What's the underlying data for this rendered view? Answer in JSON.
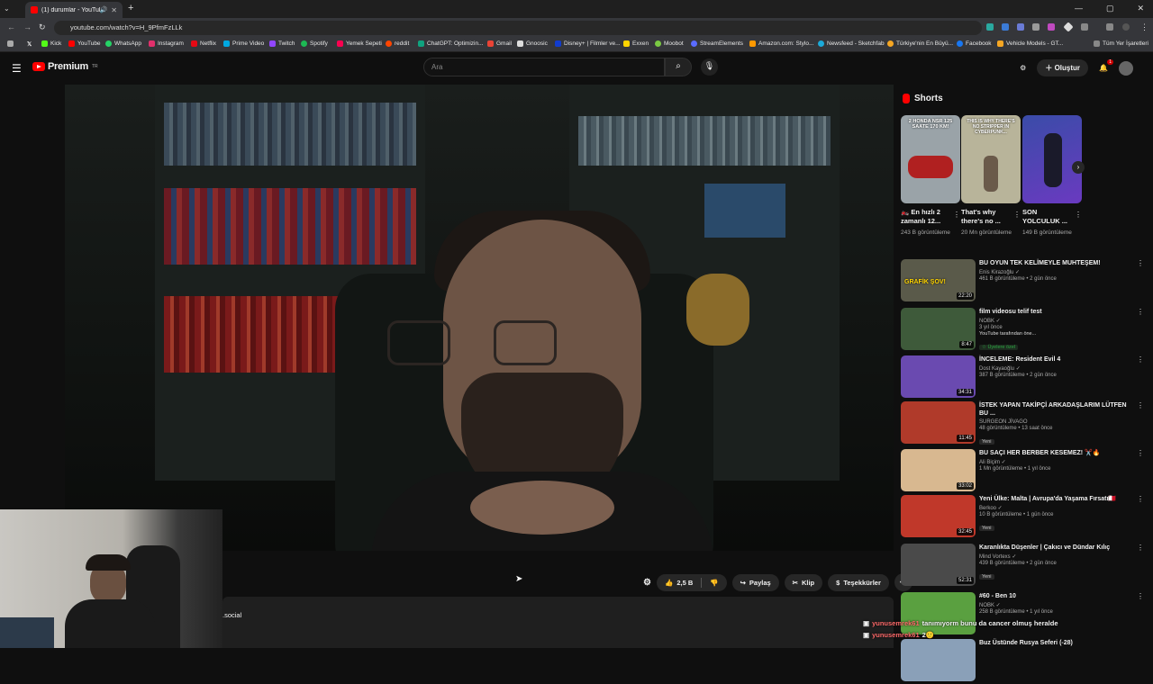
{
  "browser": {
    "tab_title": "(1) durumlar - YouTube",
    "url": "youtube.com/watch?v=H_9PfmFzLLk",
    "window_controls": [
      "—",
      "▢",
      "✕"
    ]
  },
  "bookmarks": [
    "Kick",
    "YouTube",
    "WhatsApp",
    "Instagram",
    "Netflix",
    "Prime Video",
    "Twitch",
    "Spotify",
    "Yemek Sepeti",
    "reddit",
    "ChatGPT: Optimizin...",
    "Gmail",
    "Gnoosic",
    "Disney+ | Filmler ve...",
    "Exxen",
    "Moobot",
    "StreamElements",
    "Amazon.com: Stylo...",
    "Newsfeed - Sketchfab",
    "Türkiye'nin En Büyü...",
    "Facebook",
    "Vehicle Models - GT..."
  ],
  "bookmarks_all": "Tüm Yer İşaretleri",
  "youtube": {
    "logo_text": "Premium",
    "logo_region": "TR",
    "search_placeholder": "Ara",
    "create_label": "Oluştur",
    "notif_count": "1"
  },
  "actions": {
    "like_count": "2,5 B",
    "share": "Paylaş",
    "clip": "Klip",
    "thanks": "Teşekkürler"
  },
  "description_fragment": ".social",
  "shorts": {
    "heading": "Shorts",
    "items": [
      {
        "title": "🏍️ En hızlı 2 zamanlı 12...",
        "views": "243 B görüntüleme",
        "thumb_color": "#9aa3a8",
        "thumb_text": "2 HONDA NSR 125 SAATE 170 KM!"
      },
      {
        "title": "That's why there's no ...",
        "views": "20 Mn görüntüleme",
        "thumb_color": "#b8b49a",
        "thumb_text": "THIS IS WHY THERE'S NO STRIPPER IN CYBERPUNK..."
      },
      {
        "title": "SON YOLCULUK ...",
        "views": "149 B görüntüleme",
        "thumb_color": "#3a4ca8",
        "thumb_text": ""
      }
    ]
  },
  "videos": [
    {
      "title": "BU OYUN TEK KELİMEYLE MUHTEŞEM!",
      "channel": "Enis Kirazoğlu ✓",
      "meta": "461 B görüntüleme • 2 gün önce",
      "duration": "22:20",
      "thumb_color": "#5a5a4a",
      "thumb_text": "GRAFİK ŞOV!"
    },
    {
      "title": "film videosu telif test",
      "channel": "NOBK ✓",
      "meta": "3 yıl önce",
      "duration": "8:47",
      "thumb_color": "#3e5a3a",
      "extra": "YouTube tarafından öne...",
      "member": "☆ Üyelere özel"
    },
    {
      "title": "İNCELEME: Resident Evil 4",
      "channel": "Dost Kayaoğlu ✓",
      "meta": "387 B görüntüleme • 2 gün önce",
      "duration": "34:31",
      "thumb_color": "#6a4ab0"
    },
    {
      "title": "İSTEK YAPAN TAKİPÇİ ARKADAŞLARIM LÜTFEN BU ...",
      "channel": "SURGEON JİVAGO",
      "meta": "48 görüntüleme • 13 saat önce",
      "duration": "11:45",
      "thumb_color": "#b03a2a",
      "tag": "Yeni"
    },
    {
      "title": "BU SAÇI HER BERBER KESEMEZ! ✂️🔥",
      "channel": "Ali Biçim ✓",
      "meta": "1 Mn görüntüleme • 1 yıl önce",
      "duration": "33:02",
      "thumb_color": "#d8b890"
    },
    {
      "title": "Yeni Ülke: Malta | Avrupa'da Yaşama Fırsatı🇲🇹",
      "channel": "Berkoo ✓",
      "meta": "10 B görüntüleme • 1 gün önce",
      "duration": "32:45",
      "thumb_color": "#c0382a",
      "tag": "Yeni"
    },
    {
      "title": "Karanlıkta Düşenler | Çakıcı ve Dündar Kılıç",
      "channel": "Mind Vortexs ✓",
      "meta": "439 B görüntüleme • 2 gün önce",
      "duration": "52:31",
      "thumb_color": "#4a4a4a",
      "tag": "Yeni"
    },
    {
      "title": "#60 - Ben 10",
      "channel": "NOBK ✓",
      "meta": "258 B görüntüleme • 1 yıl önce",
      "duration": "",
      "thumb_color": "#5aa040"
    },
    {
      "title": "Buz Üstünde Rusya Seferi (-28)",
      "channel": "",
      "meta": "",
      "duration": "",
      "thumb_color": "#8aa0b8"
    }
  ],
  "chat": [
    {
      "user": "yunusemrek61",
      "message": "tanımıyorm bunu da cancer olmuş heralde"
    },
    {
      "user": "yunusemrek61",
      "message": "2🙂"
    }
  ]
}
